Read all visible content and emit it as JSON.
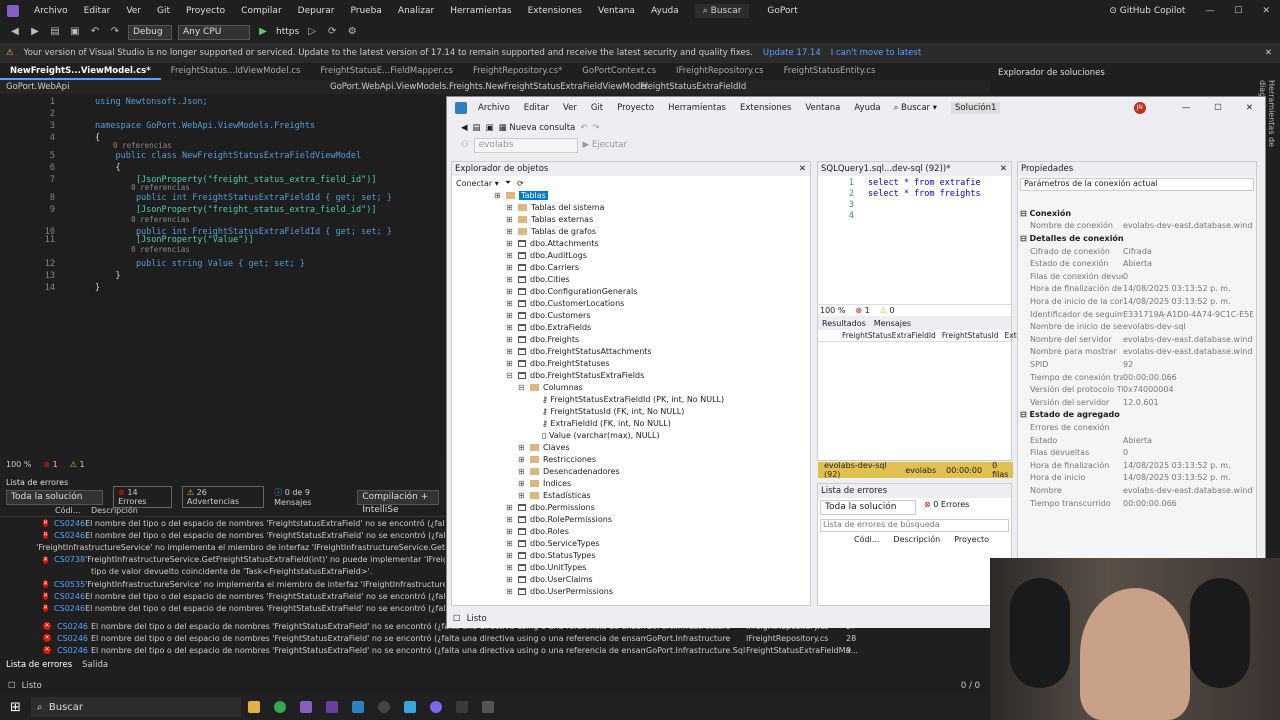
{
  "vs": {
    "menu": [
      "Archivo",
      "Editar",
      "Ver",
      "Git",
      "Proyecto",
      "Compilar",
      "Depurar",
      "Prueba",
      "Analizar",
      "Herramientas",
      "Extensiones",
      "Ventana",
      "Ayuda"
    ],
    "search": "Buscar",
    "solution_name": "GoPort",
    "copilot": "GitHub Copilot",
    "config": "Debug",
    "platform": "Any CPU",
    "run_target": "https",
    "banner_text": "Your version of Visual Studio is no longer supported or serviced. Update to the latest version of 17.14 to remain supported and receive the latest security and quality fixes.",
    "banner_update": "Update 17.14",
    "banner_dismiss": "I can't move to latest",
    "tabs": [
      "NewFreightS...ViewModel.cs*",
      "FreightStatus...ldViewModel.cs",
      "FreightStatusE...FieldMapper.cs",
      "FreightRepository.cs*",
      "GoPortContext.cs",
      "IFreightRepository.cs",
      "FreightStatusEntity.cs"
    ],
    "solution_explorer": "Explorador de soluciones",
    "nav_project": "GoPort.WebApi",
    "nav_class": "GoPort.WebApi.ViewModels.Freights.NewFreightStatusExtraFieldViewModel",
    "nav_member": "FreightStatusExtraFieldId",
    "code_lines": [
      {
        "n": "1",
        "t": "using Newtonsoft.Json;"
      },
      {
        "n": "2",
        "t": ""
      },
      {
        "n": "3",
        "t": "namespace GoPort.WebApi.ViewModels.Freights"
      },
      {
        "n": "4",
        "t": "{"
      },
      {
        "n": "",
        "t": "0 referencias"
      },
      {
        "n": "5",
        "t": "public class NewFreightStatusExtraFieldViewModel"
      },
      {
        "n": "6",
        "t": "{"
      },
      {
        "n": "7",
        "t": "[JsonProperty(\"freight_status_extra_field_id\")]"
      },
      {
        "n": "",
        "t": "0 referencias"
      },
      {
        "n": "8",
        "t": "public int FreightStatusExtraFieldId { get; set; }"
      },
      {
        "n": "9",
        "t": "[JsonProperty(\"freight_status_extra_field_id\")]"
      },
      {
        "n": "",
        "t": "0 referencias"
      },
      {
        "n": "10",
        "t": "public int FreightStatusExtraFieldId { get; set; }"
      },
      {
        "n": "11",
        "t": "[JsonProperty(\"Value\")]"
      },
      {
        "n": "",
        "t": "0 referencias"
      },
      {
        "n": "12",
        "t": "public string Value { get; set; }"
      },
      {
        "n": "13",
        "t": "}"
      },
      {
        "n": "14",
        "t": "}"
      }
    ],
    "zoom": "100 %",
    "err_count": "1",
    "warn_count": "1",
    "error_list_title": "Lista de errores",
    "scope": "Toda la solución",
    "errors_btn": "14 Errores",
    "warnings_btn": "26 Advertencias",
    "messages_btn": "0 de 9 Mensajes",
    "build_filter": "Compilación + IntelliSe",
    "col_code": "Códi...",
    "col_desc": "Descripción",
    "errors": [
      {
        "code": "CS0246",
        "desc": "El nombre del tipo o del espacio de nombres 'FreightstatusExtraField' no se encontró (¿falta una direc",
        "proj": "",
        "file": "",
        "line": ""
      },
      {
        "code": "CS0246",
        "desc": "El nombre del tipo o del espacio de nombres 'FreightStatusExtraField' no se encontró (¿falta una direc",
        "proj": "",
        "file": "",
        "line": ""
      },
      {
        "code": "",
        "desc": "'FreightInfrastructureService' no implementa el miembro de interfaz 'IFreightInfrastructureService.Get",
        "proj": "",
        "file": "",
        "line": ""
      },
      {
        "code": "CS0738",
        "desc": "'FreightInfrastructureService.GetFreightStatusExtraField(int)' no puede implementar 'IFreightInfrastru",
        "proj": "",
        "file": "",
        "line": ""
      },
      {
        "code": "",
        "desc": "tipo de valor devuelto coincidente de 'Task<FreightstatusExtraField>'.",
        "proj": "",
        "file": "",
        "line": ""
      },
      {
        "code": "CS0535",
        "desc": "'FreightInfrastructureService' no implementa el miembro de interfaz 'IFreightInfrastructureService.Cre",
        "proj": "",
        "file": "",
        "line": ""
      },
      {
        "code": "CS0246",
        "desc": "El nombre del tipo o del espacio de nombres 'FreightStatusExtraField' no se encontró (¿falta una direc",
        "proj": "",
        "file": "",
        "line": ""
      },
      {
        "code": "CS0246",
        "desc": "El nombre del tipo o del espacio de nombres 'FreightStatusExtraField' no se encontró (¿falta una direc",
        "proj": "",
        "file": "",
        "line": ""
      },
      {
        "code": "CS0246",
        "desc": "El nombre del tipo o del espacio de nombres 'FreightStatusExtraField' no se encontró (¿falta una directiva using o una referencia de ensamblado?)",
        "proj": "GoPort.Infrastructure",
        "file": "IFreightRepository.cs",
        "line": "27"
      },
      {
        "code": "CS0246",
        "desc": "El nombre del tipo o del espacio de nombres 'FreightStatusExtraField' no se encontró (¿falta una directiva using o una referencia de ensamblado?)",
        "proj": "GoPort.Infrastructure",
        "file": "IFreightRepository.cs",
        "line": "28"
      },
      {
        "code": "CS0246",
        "desc": "El nombre del tipo o del espacio de nombres 'FreightStatusExtraField' no se encontró (¿falta una directiva using o una referencia de ensamblado?)",
        "proj": "GoPort.Infrastructure.Sql",
        "file": "FreightStatusExtraFieldMa...",
        "line": "9"
      }
    ],
    "bottom_tabs": [
      "Lista de errores",
      "Salida"
    ],
    "status": "Listo",
    "line_info": "0 / 0",
    "taskbar_search": "Buscar"
  },
  "ssms": {
    "menu": [
      "Archivo",
      "Editar",
      "Ver",
      "Git",
      "Proyecto",
      "Herramientas",
      "Extensiones",
      "Ventana",
      "Ayuda"
    ],
    "search": "Buscar",
    "solution": "Solución1",
    "avatar": "JN",
    "new_query": "Nueva consulta",
    "db": "evolabs",
    "execute": "Ejecutar",
    "oe_title": "Explorador de objetos",
    "connect": "Conectar",
    "tree": [
      {
        "d": 1,
        "t": "Tablas",
        "k": "folder",
        "sel": true
      },
      {
        "d": 2,
        "t": "Tablas del sistema",
        "k": "folder"
      },
      {
        "d": 2,
        "t": "Tablas externas",
        "k": "folder"
      },
      {
        "d": 2,
        "t": "Tablas de grafos",
        "k": "folder"
      },
      {
        "d": 2,
        "t": "dbo.Attachments",
        "k": "table"
      },
      {
        "d": 2,
        "t": "dbo.AuditLogs",
        "k": "table"
      },
      {
        "d": 2,
        "t": "dbo.Carriers",
        "k": "table"
      },
      {
        "d": 2,
        "t": "dbo.Cities",
        "k": "table"
      },
      {
        "d": 2,
        "t": "dbo.ConfigurationGenerals",
        "k": "table"
      },
      {
        "d": 2,
        "t": "dbo.CustomerLocations",
        "k": "table"
      },
      {
        "d": 2,
        "t": "dbo.Customers",
        "k": "table"
      },
      {
        "d": 2,
        "t": "dbo.ExtraFields",
        "k": "table"
      },
      {
        "d": 2,
        "t": "dbo.Freights",
        "k": "table"
      },
      {
        "d": 2,
        "t": "dbo.FreightStatusAttachments",
        "k": "table"
      },
      {
        "d": 2,
        "t": "dbo.FreightStatuses",
        "k": "table"
      },
      {
        "d": 2,
        "t": "dbo.FreightStatusExtraFields",
        "k": "table",
        "open": true
      },
      {
        "d": 3,
        "t": "Columnas",
        "k": "folder",
        "open": true
      },
      {
        "d": 4,
        "t": "FreightStatusExtraFieldId (PK, int, No NULL)",
        "k": "key"
      },
      {
        "d": 4,
        "t": "FreightStatusId (FK, int, No NULL)",
        "k": "key"
      },
      {
        "d": 4,
        "t": "ExtraFieldId (FK, int, No NULL)",
        "k": "key"
      },
      {
        "d": 4,
        "t": "Value (varchar(max), NULL)",
        "k": "col"
      },
      {
        "d": 3,
        "t": "Claves",
        "k": "folder"
      },
      {
        "d": 3,
        "t": "Restricciones",
        "k": "folder"
      },
      {
        "d": 3,
        "t": "Desencadenadores",
        "k": "folder"
      },
      {
        "d": 3,
        "t": "Índices",
        "k": "folder"
      },
      {
        "d": 3,
        "t": "Estadísticas",
        "k": "folder"
      },
      {
        "d": 2,
        "t": "dbo.Permissions",
        "k": "table"
      },
      {
        "d": 2,
        "t": "dbo.RolePermissions",
        "k": "table"
      },
      {
        "d": 2,
        "t": "dbo.Roles",
        "k": "table"
      },
      {
        "d": 2,
        "t": "dbo.ServiceTypes",
        "k": "table"
      },
      {
        "d": 2,
        "t": "dbo.StatusTypes",
        "k": "table"
      },
      {
        "d": 2,
        "t": "dbo.UnitTypes",
        "k": "table"
      },
      {
        "d": 2,
        "t": "dbo.UserClaims",
        "k": "table"
      },
      {
        "d": 2,
        "t": "dbo.UserPermissions",
        "k": "table"
      }
    ],
    "query_tab": "SQLQuery1.sql...dev-sql (92))*",
    "query_lines": [
      "select * from extrafie",
      "select * from freights",
      "",
      ""
    ],
    "query_zoom": "100 %",
    "q_err": "1",
    "q_warn": "0",
    "results_tab": "Resultados",
    "messages_tab": "Mensajes",
    "res_cols": [
      "FreightStatusExtraFieldId",
      "FreightStatusId",
      "Extra"
    ],
    "conn_status": [
      "evolabs-dev-sql (92)",
      "evolabs",
      "00:00:00",
      "0 filas"
    ],
    "err_list_title": "Lista de errores",
    "err_scope": "Toda la solución",
    "err_errors": "0 Errores",
    "err_search": "Lista de errores de búsqueda",
    "err_cols": [
      "Códi...",
      "Descripción",
      "Proyecto"
    ],
    "props_title": "Propiedades",
    "props_object": "Parámetros de la conexión actual",
    "props": [
      {
        "s": true,
        "k": "Conexión"
      },
      {
        "k": "Nombre de conexión",
        "v": "evolabs-dev-east.database.windo"
      },
      {
        "s": true,
        "k": "Detalles de conexión"
      },
      {
        "k": "Cifrado de conexión",
        "v": "Cifrada"
      },
      {
        "k": "Estado de conexión",
        "v": "Abierta"
      },
      {
        "k": "Filas de conexión devueltas",
        "v": "0"
      },
      {
        "k": "Hora de finalización de la cor",
        "v": "14/08/2025 03:13:52 p. m."
      },
      {
        "k": "Hora de inicio de la conexión",
        "v": "14/08/2025 03:13:52 p. m."
      },
      {
        "k": "Identificador de seguimiento",
        "v": "E331719A-A1D0-4A74-9C1C-E5E3F"
      },
      {
        "k": "Nombre de inicio de sesión",
        "v": "evolabs-dev-sql"
      },
      {
        "k": "Nombre del servidor",
        "v": "evolabs-dev-east.database.windo"
      },
      {
        "k": "Nombre para mostrar",
        "v": "evolabs-dev-east.database.windo"
      },
      {
        "k": "SPID",
        "v": "92"
      },
      {
        "k": "Tiempo de conexión transcur",
        "v": "00:00:00.066"
      },
      {
        "k": "Versión del protocolo TDS",
        "v": "0x74000004"
      },
      {
        "k": "Versión del servidor",
        "v": "12.0.601"
      },
      {
        "s": true,
        "k": "Estado de agregado"
      },
      {
        "k": "Errores de conexión",
        "v": ""
      },
      {
        "k": "Estado",
        "v": "Abierta"
      },
      {
        "k": "Filas devueltas",
        "v": "0"
      },
      {
        "k": "Hora de finalización",
        "v": "14/08/2025 03:13:52 p. m."
      },
      {
        "k": "Hora de inicio",
        "v": "14/08/2025 03:13:52 p. m."
      },
      {
        "k": "Nombre",
        "v": "evolabs-dev-east.database.windo"
      },
      {
        "k": "Tiempo transcurrido",
        "v": "00:00:00.066"
      }
    ],
    "status": "Listo"
  },
  "side_label": "Herramientas de diagnóstico"
}
